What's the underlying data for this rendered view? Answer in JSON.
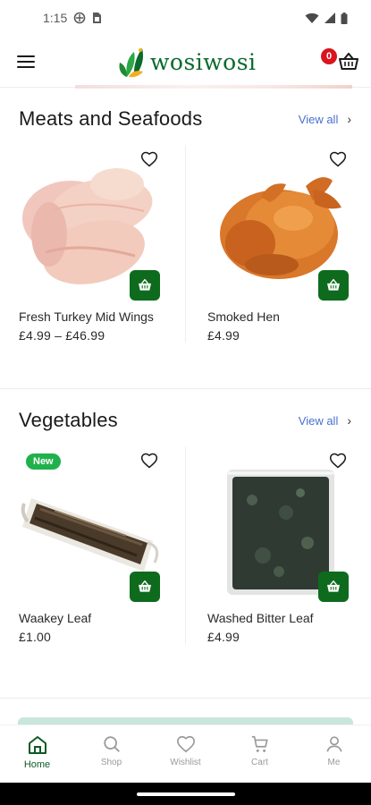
{
  "status_bar": {
    "time": "1:15"
  },
  "header": {
    "logo_text": "wosiwosi",
    "cart_count": "0"
  },
  "sections": [
    {
      "title": "Meats and Seafoods",
      "view_all": "View all",
      "products": [
        {
          "name": "Fresh Turkey Mid Wings",
          "price": "£4.99 – £46.99"
        },
        {
          "name": "Smoked Hen",
          "price": "£4.99"
        }
      ]
    },
    {
      "title": "Vegetables",
      "view_all": "View all",
      "products": [
        {
          "name": "Waakey Leaf",
          "price": "£1.00",
          "badge": "New"
        },
        {
          "name": "Washed Bitter Leaf",
          "price": "£4.99"
        }
      ]
    }
  ],
  "bottom_nav": [
    {
      "label": "Home",
      "icon": "home-icon",
      "active": true
    },
    {
      "label": "Shop",
      "icon": "search-icon"
    },
    {
      "label": "Wishlist",
      "icon": "heart-icon"
    },
    {
      "label": "Cart",
      "icon": "cart-icon"
    },
    {
      "label": "Me",
      "icon": "user-icon"
    }
  ],
  "colors": {
    "brand_green": "#0e6b1d",
    "badge_red": "#d9141f",
    "link_blue": "#4a6fd0",
    "new_badge": "#21b14c"
  }
}
